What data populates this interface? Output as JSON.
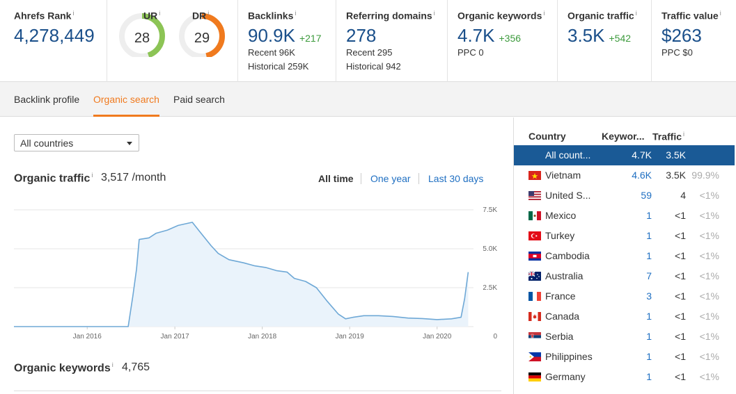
{
  "stats": {
    "ahrefs_rank": {
      "label": "Ahrefs Rank",
      "info": "i",
      "value": "4,278,449"
    },
    "ur": {
      "label": "UR",
      "info": "i",
      "value": "28",
      "fraction": 0.28
    },
    "dr": {
      "label": "DR",
      "info": "i",
      "value": "29",
      "fraction": 0.29
    },
    "backlinks": {
      "label": "Backlinks",
      "info": "i",
      "value": "90.9K",
      "delta": "+217",
      "recent": "Recent 96K",
      "historical": "Historical 259K"
    },
    "referring_domains": {
      "label": "Referring domains",
      "info": "i",
      "value": "278",
      "recent": "Recent 295",
      "historical": "Historical 942"
    },
    "organic_keywords": {
      "label": "Organic keywords",
      "info": "i",
      "value": "4.7K",
      "delta": "+356",
      "ppc": "PPC 0"
    },
    "organic_traffic": {
      "label": "Organic traffic",
      "info": "i",
      "value": "3.5K",
      "delta": "+542"
    },
    "traffic_value": {
      "label": "Traffic value",
      "info": "i",
      "value": "$263",
      "ppc": "PPC $0"
    }
  },
  "tabs": [
    {
      "label": "Backlink profile",
      "active": false
    },
    {
      "label": "Organic search",
      "active": true
    },
    {
      "label": "Paid search",
      "active": false
    }
  ],
  "country_select": {
    "value": "All countries"
  },
  "organic_traffic_section": {
    "title": "Organic traffic",
    "info": "i",
    "value": "3,517 /month"
  },
  "ranges": {
    "all_time": "All time",
    "one_year": "One year",
    "last_30_days": "Last 30 days",
    "selected": "all_time"
  },
  "organic_keywords_section": {
    "title": "Organic keywords",
    "info": "i",
    "value": "4,765"
  },
  "chart_data": {
    "type": "area",
    "x_tick_labels": [
      "Jan 2016",
      "Jan 2017",
      "Jan 2018",
      "Jan 2019",
      "Jan 2020"
    ],
    "y_tick_labels": [
      "7.5K",
      "5.0K",
      "2.5K",
      "0"
    ],
    "ylim": [
      0,
      7500
    ],
    "xlim": [
      "2015-03-01",
      "2020-06-01"
    ],
    "grid": true,
    "series": [
      {
        "points": [
          [
            "2015-03-01",
            0
          ],
          [
            "2016-06-20",
            0
          ],
          [
            "2016-07-10",
            2000
          ],
          [
            "2016-07-25",
            3700
          ],
          [
            "2016-08-05",
            5600
          ],
          [
            "2016-09-15",
            5700
          ],
          [
            "2016-10-15",
            6000
          ],
          [
            "2016-12-01",
            6200
          ],
          [
            "2017-01-15",
            6500
          ],
          [
            "2017-03-15",
            6700
          ],
          [
            "2017-04-15",
            6100
          ],
          [
            "2017-06-01",
            5200
          ],
          [
            "2017-07-01",
            4700
          ],
          [
            "2017-08-15",
            4300
          ],
          [
            "2017-10-15",
            4100
          ],
          [
            "2017-12-01",
            3900
          ],
          [
            "2018-01-15",
            3800
          ],
          [
            "2018-03-01",
            3600
          ],
          [
            "2018-04-15",
            3500
          ],
          [
            "2018-05-15",
            3100
          ],
          [
            "2018-07-01",
            2900
          ],
          [
            "2018-08-15",
            2500
          ],
          [
            "2018-10-01",
            1600
          ],
          [
            "2018-11-15",
            800
          ],
          [
            "2018-12-15",
            500
          ],
          [
            "2019-01-15",
            600
          ],
          [
            "2019-03-01",
            700
          ],
          [
            "2019-05-01",
            700
          ],
          [
            "2019-07-01",
            650
          ],
          [
            "2019-09-01",
            550
          ],
          [
            "2019-11-01",
            520
          ],
          [
            "2020-01-01",
            450
          ],
          [
            "2020-03-01",
            500
          ],
          [
            "2020-04-10",
            600
          ],
          [
            "2020-04-25",
            1800
          ],
          [
            "2020-05-10",
            3500
          ]
        ]
      }
    ],
    "colors": {
      "line": "#6ea8d6",
      "fill": "#eaf3fb"
    }
  },
  "country_table": {
    "headers": {
      "country": "Country",
      "keywords": "Keywor...",
      "traffic": "Traffic",
      "info": "i"
    },
    "rows": [
      {
        "country": "All count...",
        "keywords": "4.7K",
        "traffic": "3.5K",
        "share": "",
        "flag": "none",
        "selected": true
      },
      {
        "country": "Vietnam",
        "keywords": "4.6K",
        "traffic": "3.5K",
        "share": "99.9%",
        "flag": "vn"
      },
      {
        "country": "United S...",
        "keywords": "59",
        "traffic": "4",
        "share": "<1%",
        "flag": "us"
      },
      {
        "country": "Mexico",
        "keywords": "1",
        "traffic": "<1",
        "share": "<1%",
        "flag": "mx"
      },
      {
        "country": "Turkey",
        "keywords": "1",
        "traffic": "<1",
        "share": "<1%",
        "flag": "tr"
      },
      {
        "country": "Cambodia",
        "keywords": "1",
        "traffic": "<1",
        "share": "<1%",
        "flag": "kh"
      },
      {
        "country": "Australia",
        "keywords": "7",
        "traffic": "<1",
        "share": "<1%",
        "flag": "au"
      },
      {
        "country": "France",
        "keywords": "3",
        "traffic": "<1",
        "share": "<1%",
        "flag": "fr"
      },
      {
        "country": "Canada",
        "keywords": "1",
        "traffic": "<1",
        "share": "<1%",
        "flag": "ca"
      },
      {
        "country": "Serbia",
        "keywords": "1",
        "traffic": "<1",
        "share": "<1%",
        "flag": "rs"
      },
      {
        "country": "Philippines",
        "keywords": "1",
        "traffic": "<1",
        "share": "<1%",
        "flag": "ph"
      },
      {
        "country": "Germany",
        "keywords": "1",
        "traffic": "<1",
        "share": "<1%",
        "flag": "de"
      }
    ]
  },
  "colors": {
    "accent": "#f07a1e",
    "link": "#1f6fc2",
    "value_blue": "#1a4f8a",
    "positive": "#3c9a3c",
    "selected_row": "#1a5a96",
    "ur_ring": "#8cc455",
    "dr_ring": "#f07a1e",
    "ring_track": "#eeeeee"
  }
}
